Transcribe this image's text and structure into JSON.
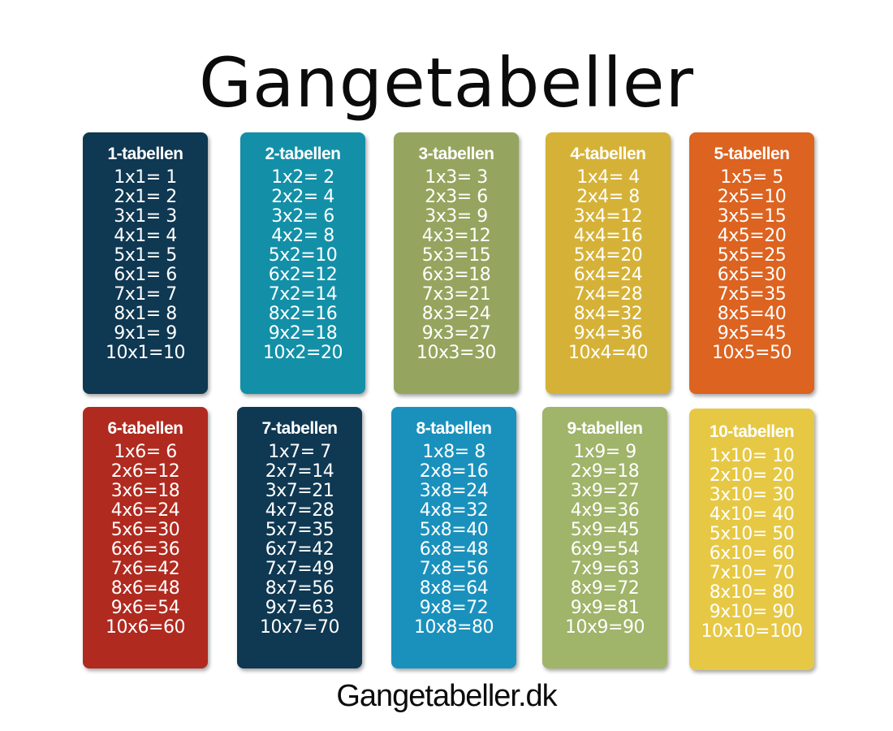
{
  "title": "Gangetabeller",
  "footer": "Gangetabeller.dk",
  "colors": {
    "navy": "#0f3852",
    "teal": "#1390a8",
    "olive": "#95a55f",
    "mustard": "#d5b237",
    "orange": "#dc6320",
    "red": "#b02a1f",
    "blue": "#1a91bd",
    "green": "#a0b46a",
    "yellow": "#e6c844"
  },
  "tables": [
    {
      "header": "1-tabellen",
      "rows": [
        "1x1= 1",
        "2x1= 2",
        "3x1= 3",
        "4x1= 4",
        "5x1= 5",
        "6x1= 6",
        "7x1= 7",
        "8x1= 8",
        "9x1= 9",
        "10x1=10"
      ]
    },
    {
      "header": "2-tabellen",
      "rows": [
        "1x2= 2",
        "2x2= 4",
        "3x2= 6",
        "4x2= 8",
        "5x2=10",
        "6x2=12",
        "7x2=14",
        "8x2=16",
        "9x2=18",
        "10x2=20"
      ]
    },
    {
      "header": "3-tabellen",
      "rows": [
        "1x3= 3",
        "2x3= 6",
        "3x3= 9",
        "4x3=12",
        "5x3=15",
        "6x3=18",
        "7x3=21",
        "8x3=24",
        "9x3=27",
        "10x3=30"
      ]
    },
    {
      "header": "4-tabellen",
      "rows": [
        "1x4= 4",
        "2x4= 8",
        "3x4=12",
        "4x4=16",
        "5x4=20",
        "6x4=24",
        "7x4=28",
        "8x4=32",
        "9x4=36",
        "10x4=40"
      ]
    },
    {
      "header": "5-tabellen",
      "rows": [
        "1x5= 5",
        "2x5=10",
        "3x5=15",
        "4x5=20",
        "5x5=25",
        "6x5=30",
        "7x5=35",
        "8x5=40",
        "9x5=45",
        "10x5=50"
      ]
    },
    {
      "header": "6-tabellen",
      "rows": [
        "1x6= 6",
        "2x6=12",
        "3x6=18",
        "4x6=24",
        "5x6=30",
        "6x6=36",
        "7x6=42",
        "8x6=48",
        "9x6=54",
        "10x6=60"
      ]
    },
    {
      "header": "7-tabellen",
      "rows": [
        "1x7= 7",
        "2x7=14",
        "3x7=21",
        "4x7=28",
        "5x7=35",
        "6x7=42",
        "7x7=49",
        "8x7=56",
        "9x7=63",
        "10x7=70"
      ]
    },
    {
      "header": "8-tabellen",
      "rows": [
        "1x8= 8",
        "2x8=16",
        "3x8=24",
        "4x8=32",
        "5x8=40",
        "6x8=48",
        "7x8=56",
        "8x8=64",
        "9x8=72",
        "10x8=80"
      ]
    },
    {
      "header": "9-tabellen",
      "rows": [
        "1x9= 9",
        "2x9=18",
        "3x9=27",
        "4x9=36",
        "5x9=45",
        "6x9=54",
        "7x9=63",
        "8x9=72",
        "9x9=81",
        "10x9=90"
      ]
    },
    {
      "header": "10-tabellen",
      "rows": [
        "1x10= 10",
        "2x10= 20",
        "3x10= 30",
        "4x10= 40",
        "5x10= 50",
        "6x10= 60",
        "7x10= 70",
        "8x10= 80",
        "9x10= 90",
        "10x10=100"
      ]
    }
  ]
}
